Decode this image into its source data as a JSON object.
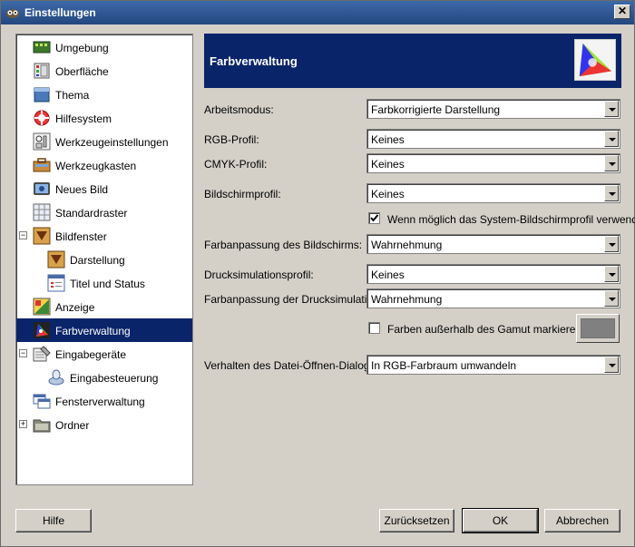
{
  "window": {
    "title": "Einstellungen"
  },
  "nav": {
    "items": [
      {
        "label": "Umgebung",
        "icon": "environment-icon"
      },
      {
        "label": "Oberfläche",
        "icon": "interface-icon"
      },
      {
        "label": "Thema",
        "icon": "theme-icon"
      },
      {
        "label": "Hilfesystem",
        "icon": "help-system-icon"
      },
      {
        "label": "Werkzeugeinstellungen",
        "icon": "tool-options-icon"
      },
      {
        "label": "Werkzeugkasten",
        "icon": "toolbox-icon"
      },
      {
        "label": "Neues Bild",
        "icon": "new-image-icon"
      },
      {
        "label": "Standardraster",
        "icon": "default-grid-icon"
      },
      {
        "label": "Bildfenster",
        "icon": "image-window-icon",
        "expanded": true
      },
      {
        "label": "Darstellung",
        "icon": "appearance-icon"
      },
      {
        "label": "Titel und Status",
        "icon": "title-status-icon"
      },
      {
        "label": "Anzeige",
        "icon": "display-icon"
      },
      {
        "label": "Farbverwaltung",
        "icon": "color-management-icon",
        "selected": true
      },
      {
        "label": "Eingabegeräte",
        "icon": "input-devices-icon",
        "expanded": true
      },
      {
        "label": "Eingabesteuerung",
        "icon": "input-controllers-icon"
      },
      {
        "label": "Fensterverwaltung",
        "icon": "window-management-icon"
      },
      {
        "label": "Ordner",
        "icon": "folders-icon",
        "expanded": false
      }
    ]
  },
  "header": {
    "title": "Farbverwaltung",
    "icon": "color-gamut-icon"
  },
  "form": {
    "arbeitsmodus": {
      "label": "Arbeitsmodus:",
      "value": "Farbkorrigierte Darstellung"
    },
    "rgb_profil": {
      "label": "RGB-Profil:",
      "value": "Keines"
    },
    "cmyk_profil": {
      "label": "CMYK-Profil:",
      "value": "Keines"
    },
    "bildschirmprofil": {
      "label": "Bildschirmprofil:",
      "value": "Keines"
    },
    "system_profil": {
      "label": "Wenn möglich das System-Bildschirmprofil verwenden",
      "checked": true
    },
    "farbanpassung_bildschirm": {
      "label": "Farbanpassung des Bildschirms:",
      "value": "Wahrnehmung"
    },
    "drucksimulationsprofil": {
      "label": "Drucksimulationsprofil:",
      "value": "Keines"
    },
    "farbanpassung_druck": {
      "label": "Farbanpassung der Drucksimulation:",
      "value": "Wahrnehmung"
    },
    "gamut_markieren": {
      "label": "Farben außerhalb des Gamut markieren",
      "checked": false,
      "color": "#808080"
    },
    "datei_oeffnen": {
      "label": "Verhalten des Datei-Öffnen-Dialogs:",
      "value": "In RGB-Farbraum umwandeln"
    }
  },
  "buttons": {
    "help": "Hilfe",
    "reset": "Zurücksetzen",
    "ok": "OK",
    "cancel": "Abbrechen"
  },
  "colors": {
    "selection": "#0a246a",
    "background": "#d4d0c8"
  }
}
